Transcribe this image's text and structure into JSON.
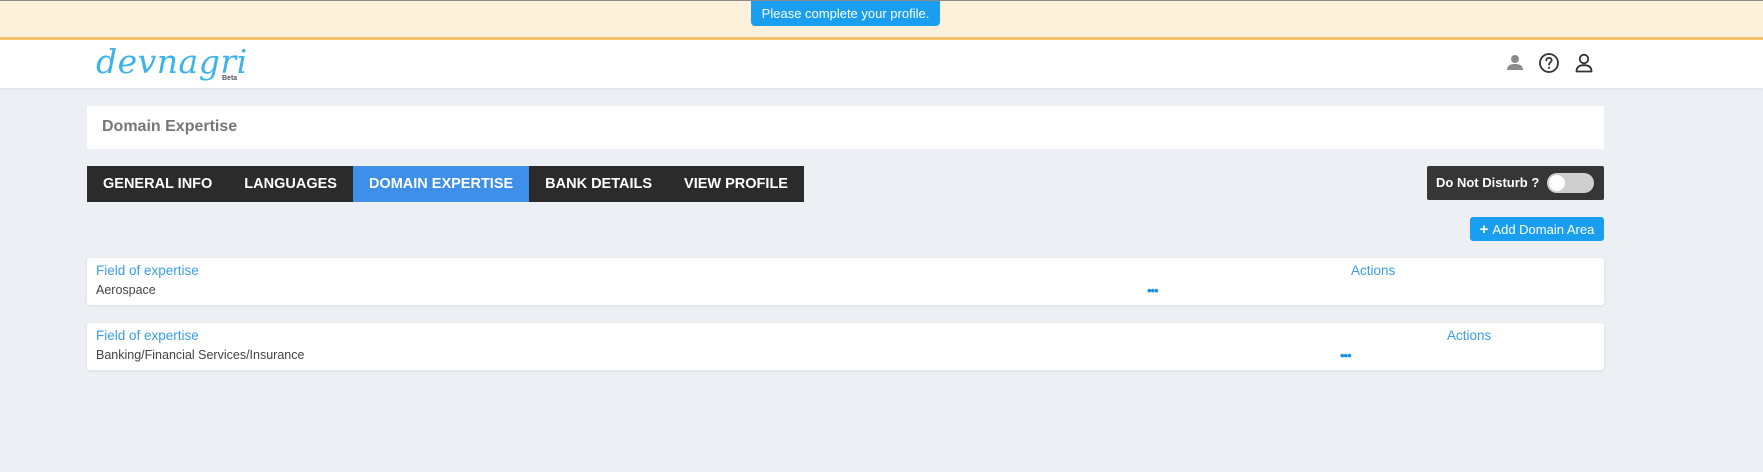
{
  "notice": {
    "text": "Please complete your profile."
  },
  "header": {
    "logo_text": "devnagri",
    "logo_badge": "Beta",
    "icons": [
      "user-small-icon",
      "help-icon",
      "user-account-icon"
    ]
  },
  "page": {
    "title": "Domain Expertise"
  },
  "tabs": [
    {
      "label": "GENERAL INFO",
      "active": false
    },
    {
      "label": "LANGUAGES",
      "active": false
    },
    {
      "label": "DOMAIN EXPERTISE",
      "active": true
    },
    {
      "label": "BANK DETAILS",
      "active": false
    },
    {
      "label": "VIEW PROFILE",
      "active": false
    }
  ],
  "dnd": {
    "label": "Do Not Disturb ?",
    "enabled": false
  },
  "add_button": {
    "label": "Add Domain Area"
  },
  "rows": [
    {
      "field_header": "Field of expertise",
      "actions_header": "Actions",
      "value": "Aerospace",
      "more": "•••"
    },
    {
      "field_header": "Field of expertise",
      "actions_header": "Actions",
      "value": "Banking/Financial Services/Insurance",
      "more": "•••"
    }
  ],
  "colors": {
    "accent": "#1a9ff0",
    "active_tab": "#3e8fea",
    "tab_bar": "#2b2b2b",
    "notice_bg": "#fdf1dc",
    "page_bg": "#eceff3"
  }
}
